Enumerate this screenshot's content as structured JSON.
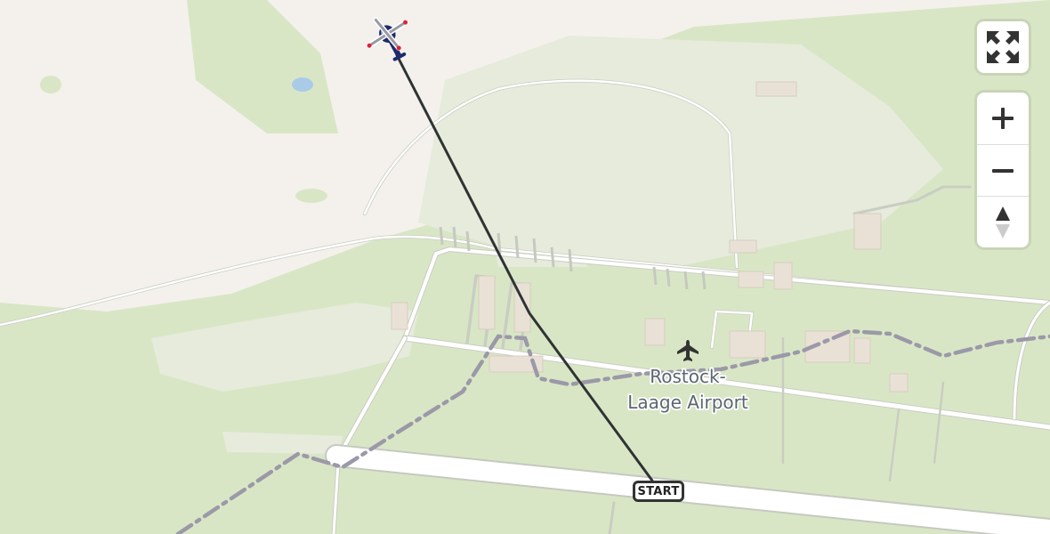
{
  "map": {
    "airport_label_line1": "Rostock-",
    "airport_label_line2": "Laage Airport",
    "airport_icon": "airplane-icon"
  },
  "route": {
    "start_label": "START",
    "aircraft_icon": "helicopter-icon",
    "line_color": "#2f3334"
  },
  "controls": {
    "fullscreen_icon": "expand-arrows-icon",
    "zoom_in_icon": "plus-icon",
    "zoom_out_icon": "minus-icon",
    "compass_icon": "compass-north-icon"
  },
  "colors": {
    "land": "#f4f1ec",
    "forest": "#d9e6c6",
    "airport_area": "#e7eadf",
    "roads": "#ffffff",
    "boundary": "#9b99a8"
  }
}
